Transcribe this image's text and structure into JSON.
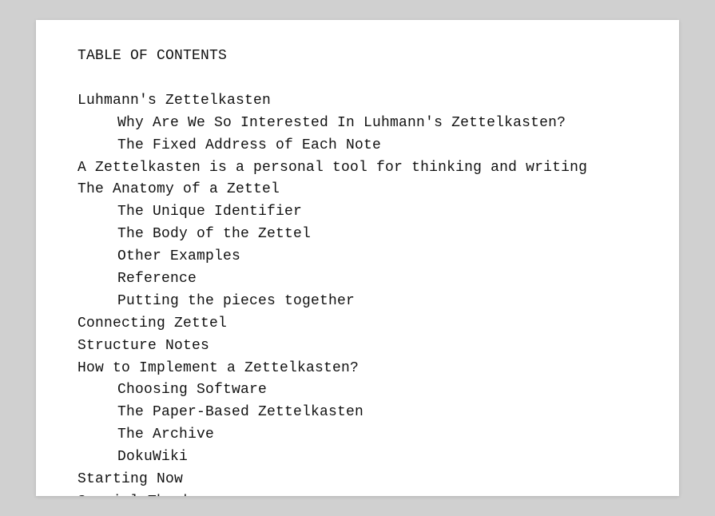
{
  "title": "TABLE OF CONTENTS",
  "entries": [
    {
      "level": 1,
      "text": "Luhmann's Zettelkasten"
    },
    {
      "level": 2,
      "text": "Why Are We So Interested In Luhmann's Zettelkasten?"
    },
    {
      "level": 2,
      "text": "The Fixed Address of Each Note"
    },
    {
      "level": 1,
      "text": "A Zettelkasten is a personal tool for thinking and writing"
    },
    {
      "level": 1,
      "text": "The Anatomy of a Zettel"
    },
    {
      "level": 2,
      "text": "The Unique Identifier"
    },
    {
      "level": 2,
      "text": "The Body of the Zettel"
    },
    {
      "level": 2,
      "text": "Other Examples"
    },
    {
      "level": 2,
      "text": "Reference"
    },
    {
      "level": 2,
      "text": "Putting the pieces together"
    },
    {
      "level": 1,
      "text": "Connecting Zettel"
    },
    {
      "level": 1,
      "text": "Structure Notes"
    },
    {
      "level": 1,
      "text": "How to Implement a Zettelkasten?"
    },
    {
      "level": 2,
      "text": "Choosing Software"
    },
    {
      "level": 2,
      "text": "The Paper-Based Zettelkasten"
    },
    {
      "level": 2,
      "text": "The Archive"
    },
    {
      "level": 2,
      "text": "DokuWiki"
    },
    {
      "level": 1,
      "text": "Starting Now"
    },
    {
      "level": 1,
      "text": "Special Thanks"
    }
  ]
}
